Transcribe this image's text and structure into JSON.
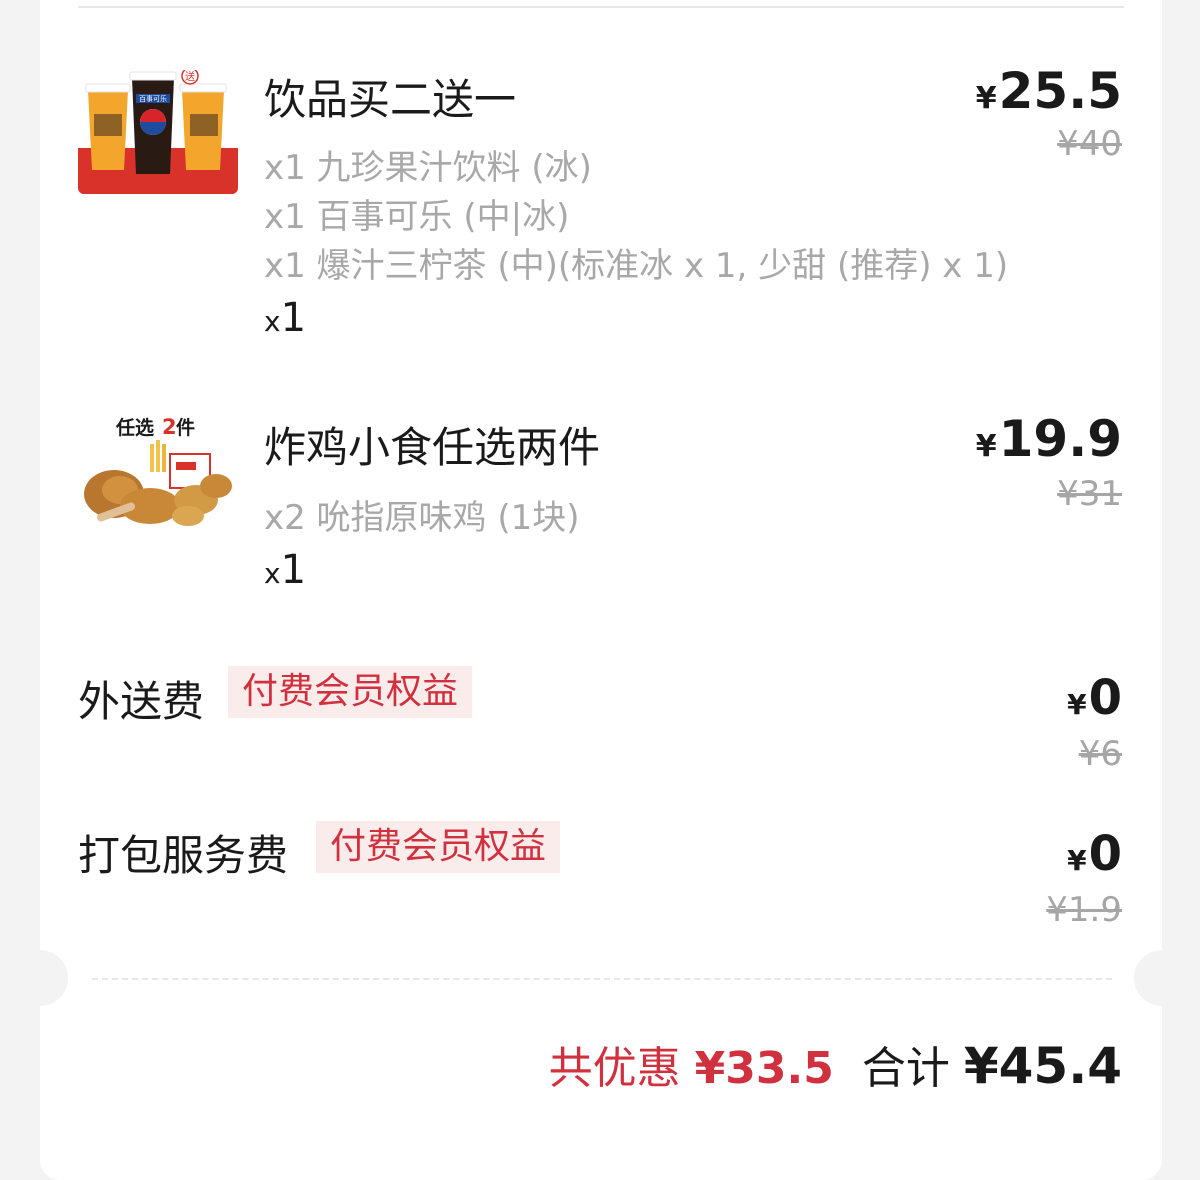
{
  "items": [
    {
      "name": "饮品买二送一",
      "price_symbol": "¥",
      "price": "25.5",
      "original_price": "¥40",
      "details": [
        "x1 九珍果汁饮料 (冰)",
        "x1 百事可乐 (中|冰)",
        "x1 爆汁三柠茶 (中)(标准冰 x 1, 少甜 (推荐) x 1)"
      ],
      "qty_prefix": "x",
      "qty": "1",
      "image_badge": "送",
      "image_label": "百事可乐"
    },
    {
      "name": "炸鸡小食任选两件",
      "price_symbol": "¥",
      "price": "19.9",
      "original_price": "¥31",
      "details": [
        "x2 吮指原味鸡 (1块)"
      ],
      "qty_prefix": "x",
      "qty": "1",
      "image_label_pre": "任选",
      "image_label_num": "2",
      "image_label_post": "件"
    }
  ],
  "fees": [
    {
      "label": "外送费",
      "badge": "付费会员权益",
      "price_symbol": "¥",
      "price": "0",
      "original_price": "¥6"
    },
    {
      "label": "打包服务费",
      "badge": "付费会员权益",
      "price_symbol": "¥",
      "price": "0",
      "original_price": "¥1.9"
    }
  ],
  "summary": {
    "discount_label": "共优惠",
    "discount_value": "¥33.5",
    "total_label": "合计",
    "total_value": "¥45.4"
  },
  "colors": {
    "accent_red": "#d1313f",
    "badge_bg": "#fbecec",
    "muted_text": "#a8a8a8"
  }
}
